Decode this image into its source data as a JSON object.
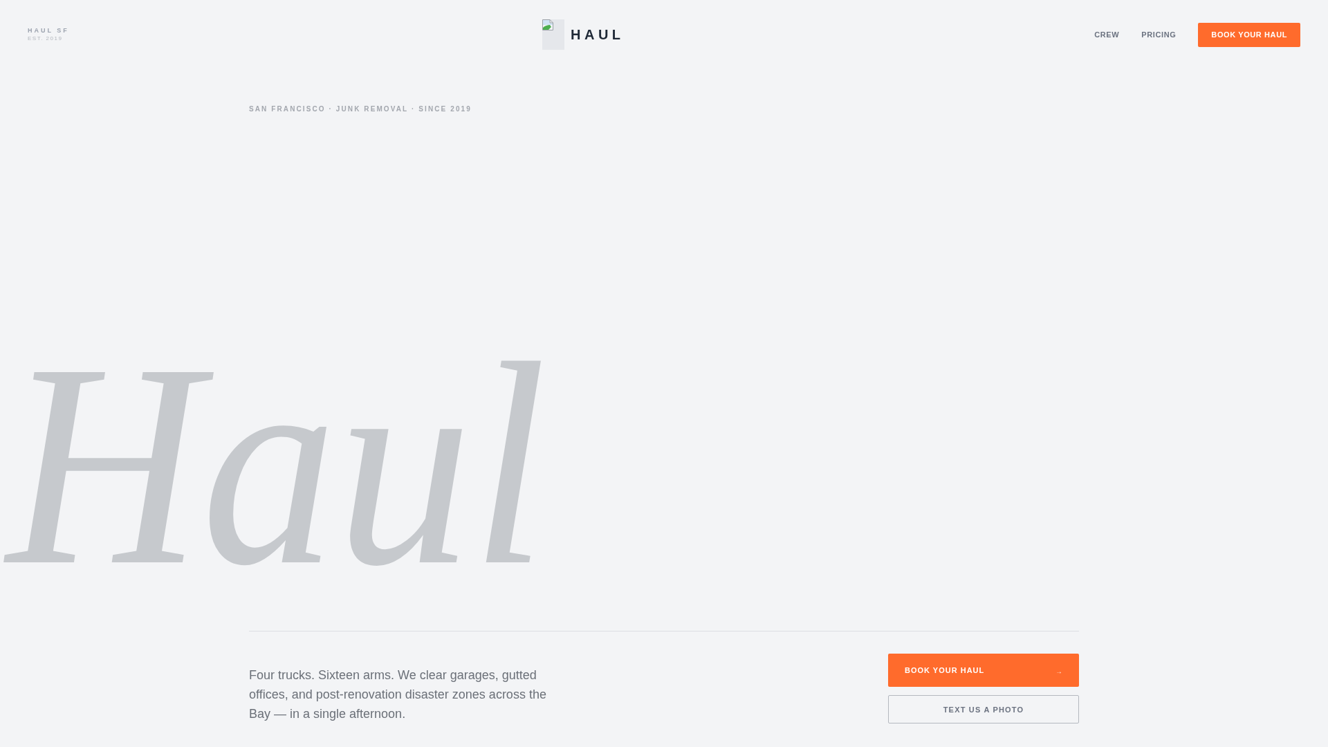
{
  "header": {
    "brand": {
      "name": "HAUL SF",
      "established": "EST. 2019"
    },
    "logo": {
      "text": "HAUL"
    },
    "nav": [
      {
        "label": "CREW"
      },
      {
        "label": "PRICING"
      }
    ],
    "cta": {
      "label": "BOOK YOUR HAUL"
    }
  },
  "hero": {
    "eyebrow": "SAN FRANCISCO · JUNK REMOVAL · SINCE 2019",
    "display_word": "Haul",
    "description": "Four trucks. Sixteen arms. We clear garages, gutted offices, and post-renovation disaster zones across the Bay — in a single afternoon.",
    "actions": [
      {
        "kind": "primary",
        "label": "BOOK YOUR HAUL",
        "arrow": "→"
      },
      {
        "kind": "secondary",
        "label": "TEXT US A PHOTO"
      }
    ]
  }
}
